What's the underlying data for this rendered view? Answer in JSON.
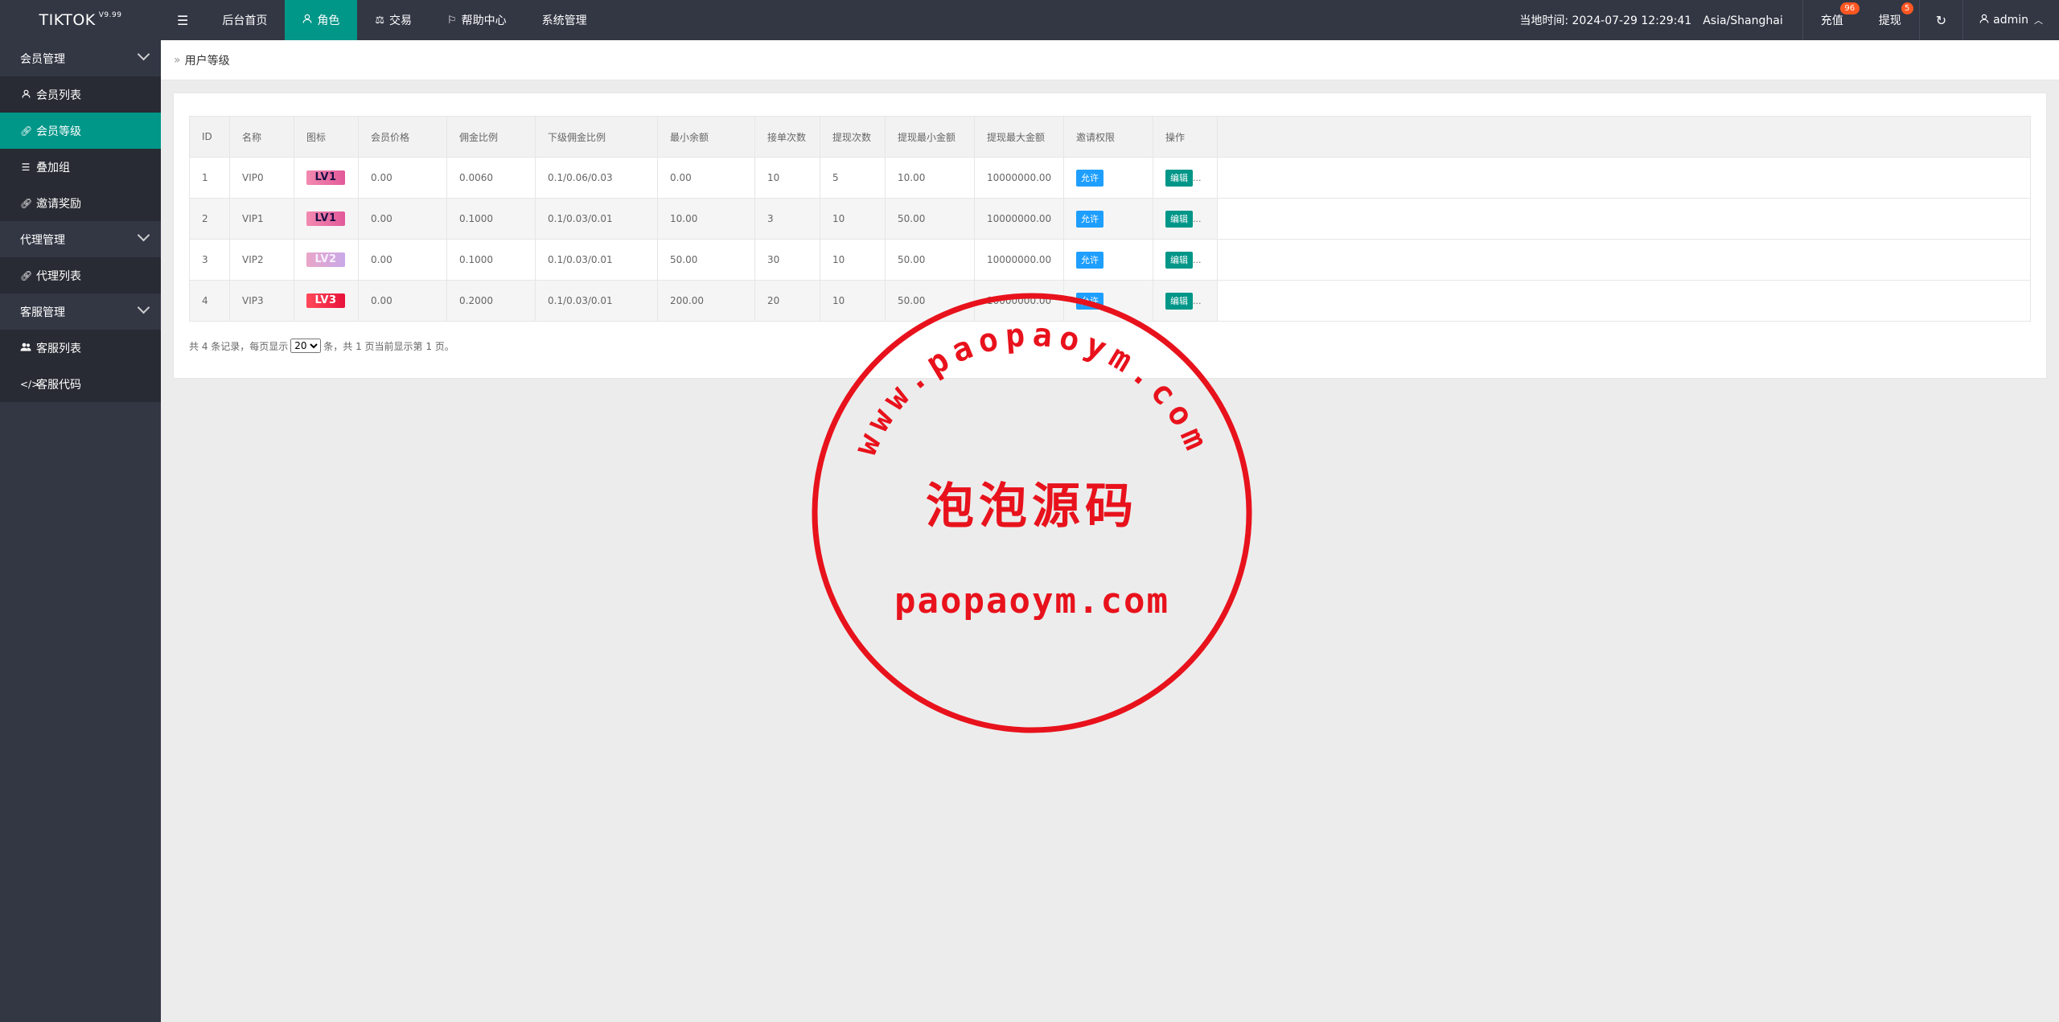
{
  "app": {
    "name": "TIKTOK",
    "version": "V9.99"
  },
  "nav": {
    "items": [
      "后台首页",
      "角色",
      "交易",
      "帮助中心",
      "系统管理"
    ]
  },
  "header": {
    "time_label": "当地时间: 2024-07-29 12:29:41",
    "timezone": "Asia/Shanghai",
    "recharge": {
      "label": "充值",
      "badge": "96"
    },
    "withdraw": {
      "label": "提现",
      "badge": "5"
    },
    "user": "admin"
  },
  "sidebar": {
    "sections": [
      {
        "title": "会员管理",
        "items": [
          {
            "label": "会员列表",
            "icon": "user-icon"
          },
          {
            "label": "会员等级",
            "icon": "link-icon"
          },
          {
            "label": "叠加组",
            "icon": "list-icon"
          },
          {
            "label": "邀请奖励",
            "icon": "link-icon"
          }
        ]
      },
      {
        "title": "代理管理",
        "items": [
          {
            "label": "代理列表",
            "icon": "link-icon"
          }
        ]
      },
      {
        "title": "客服管理",
        "items": [
          {
            "label": "客服列表",
            "icon": "users-icon"
          },
          {
            "label": "客服代码",
            "icon": "code-icon"
          }
        ]
      }
    ]
  },
  "breadcrumb": "用户等级",
  "table": {
    "headers": [
      "ID",
      "名称",
      "图标",
      "会员价格",
      "佣金比例",
      "下级佣金比例",
      "最小余额",
      "接单次数",
      "提现次数",
      "提现最小金额",
      "提现最大金额",
      "邀请权限",
      "操作"
    ],
    "rows": [
      {
        "id": "1",
        "name": "VIP0",
        "icon": "LV1",
        "price": "0.00",
        "commission": "0.0060",
        "sub_commission": "0.1/0.06/0.03",
        "min_balance": "0.00",
        "orders": "10",
        "withdraw_times": "5",
        "withdraw_min": "10.00",
        "withdraw_max": "10000000.00",
        "invite": "允许",
        "action": "编辑",
        "more": "..."
      },
      {
        "id": "2",
        "name": "VIP1",
        "icon": "LV1",
        "price": "0.00",
        "commission": "0.1000",
        "sub_commission": "0.1/0.03/0.01",
        "min_balance": "10.00",
        "orders": "3",
        "withdraw_times": "10",
        "withdraw_min": "50.00",
        "withdraw_max": "10000000.00",
        "invite": "允许",
        "action": "编辑",
        "more": "..."
      },
      {
        "id": "3",
        "name": "VIP2",
        "icon": "LV2",
        "price": "0.00",
        "commission": "0.1000",
        "sub_commission": "0.1/0.03/0.01",
        "min_balance": "50.00",
        "orders": "30",
        "withdraw_times": "10",
        "withdraw_min": "50.00",
        "withdraw_max": "10000000.00",
        "invite": "允许",
        "action": "编辑",
        "more": "..."
      },
      {
        "id": "4",
        "name": "VIP3",
        "icon": "LV3",
        "price": "0.00",
        "commission": "0.2000",
        "sub_commission": "0.1/0.03/0.01",
        "min_balance": "200.00",
        "orders": "20",
        "withdraw_times": "10",
        "withdraw_min": "50.00",
        "withdraw_max": "10000000.00",
        "invite": "允许",
        "action": "编辑",
        "more": "..."
      }
    ]
  },
  "pager": {
    "prefix": "共 4 条记录，每页显示",
    "page_size": "20",
    "suffix": "条，共 1 页当前显示第 1 页。"
  },
  "stamp": {
    "arc_text": "www.paopaoym.com",
    "title": "泡泡源码",
    "footer": "paopaoym.com",
    "color": "#e8121c"
  },
  "colors": {
    "header_bg": "#333744",
    "accent": "#009688",
    "allow_btn": "#1e9fff",
    "badge": "#ff5722"
  }
}
